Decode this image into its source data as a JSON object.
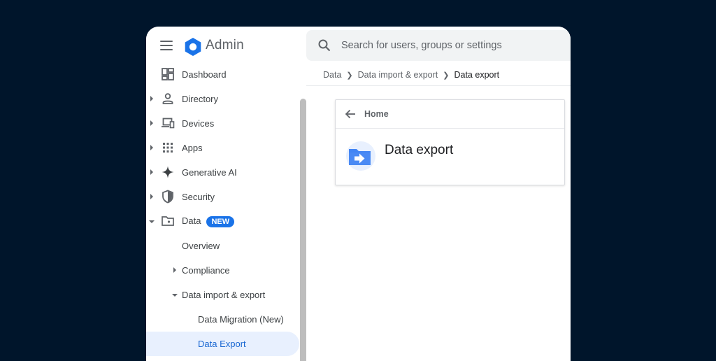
{
  "app": {
    "title": "Admin"
  },
  "search": {
    "placeholder": "Search for users, groups or settings"
  },
  "breadcrumb": {
    "items": [
      "Data",
      "Data import & export",
      "Data export"
    ]
  },
  "sidebar": {
    "items": [
      {
        "label": "Dashboard",
        "icon": "dashboard-icon"
      },
      {
        "label": "Directory",
        "icon": "person-icon"
      },
      {
        "label": "Devices",
        "icon": "devices-icon"
      },
      {
        "label": "Apps",
        "icon": "apps-grid-icon"
      },
      {
        "label": "Generative AI",
        "icon": "sparkle-icon"
      },
      {
        "label": "Security",
        "icon": "shield-icon"
      },
      {
        "label": "Data",
        "icon": "folder-icon",
        "badge": "NEW"
      }
    ],
    "data_children": {
      "overview": "Overview",
      "compliance": "Compliance",
      "import_export": "Data import & export",
      "migration": "Data Migration (New)",
      "export": "Data Export"
    }
  },
  "card": {
    "back_label": "Home",
    "title": "Data export",
    "icon": "folder-export-icon"
  },
  "colors": {
    "background": "#00152b",
    "accent": "#1a73e8",
    "active_bg": "#e8f0fe",
    "active_text": "#1967d2"
  }
}
